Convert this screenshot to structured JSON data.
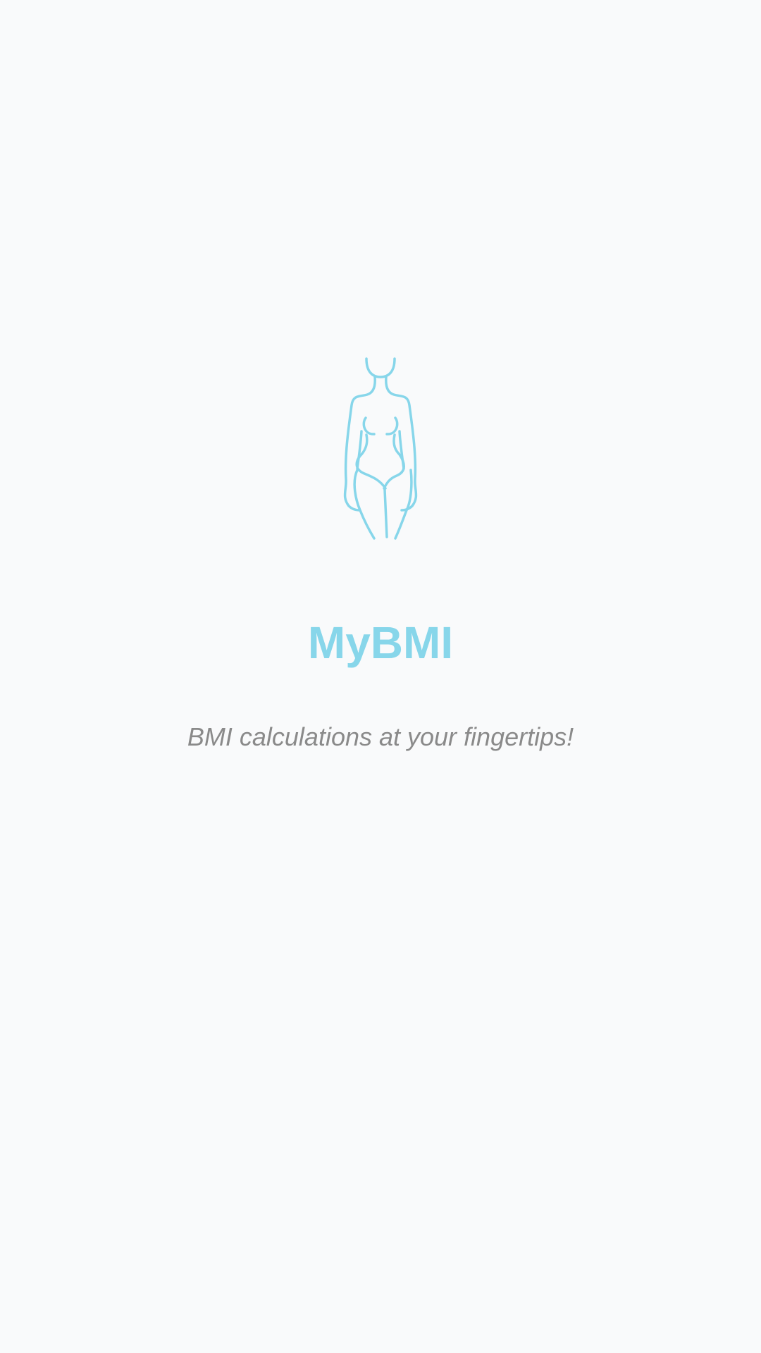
{
  "splash": {
    "logo_icon": "female-body-outline-icon",
    "title": "MyBMI",
    "tagline": "BMI calculations at your fingertips!"
  },
  "colors": {
    "background": "#f9fafb",
    "accent": "#87d6ea",
    "tagline_text": "#8a8a8a"
  }
}
